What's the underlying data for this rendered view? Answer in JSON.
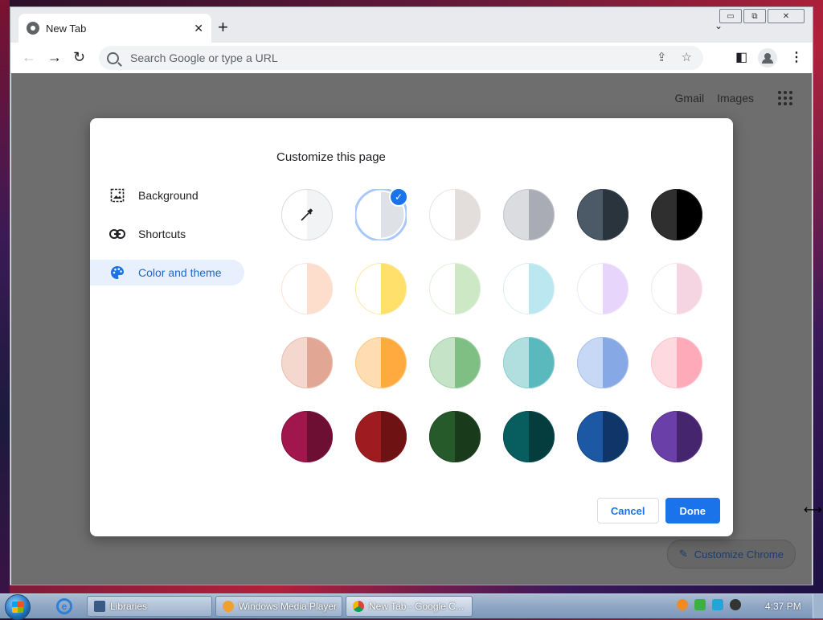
{
  "window": {
    "controls": {
      "minimize": "▭",
      "restore": "⧉",
      "close": "✕"
    }
  },
  "tab": {
    "title": "New Tab",
    "close": "✕",
    "new_tab": "+",
    "dropdown": "⌄"
  },
  "toolbar": {
    "back": "←",
    "forward": "→",
    "reload": "↻",
    "omnibox_placeholder": "Search Google or type a URL",
    "share": "⇪",
    "bookmark": "☆",
    "side_panel": "◧",
    "menu": "⋮"
  },
  "page": {
    "links": [
      "Gmail",
      "Images"
    ],
    "customize_label": "Customize Chrome"
  },
  "dialog": {
    "title": "Customize this page",
    "nav": [
      {
        "label": "Background",
        "icon": "image-icon"
      },
      {
        "label": "Shortcuts",
        "icon": "link-icon"
      },
      {
        "label": "Color and theme",
        "icon": "palette-icon",
        "active": true
      }
    ],
    "swatches": [
      {
        "name": "custom-color",
        "left": "#ffffff",
        "right": "#f1f3f4",
        "border": "#dadce0",
        "eyedropper": true
      },
      {
        "name": "default",
        "left": "#ffffff",
        "right": "#dee1e6",
        "border": "#a8c7fa",
        "selected": true
      },
      {
        "name": "warm-grey",
        "left": "#ffffff",
        "right": "#e3dedb",
        "border": "#e7e3e0"
      },
      {
        "name": "cool-grey",
        "left": "#dadce0",
        "right": "#a9acb5",
        "border": "#c3c6cc"
      },
      {
        "name": "blue-grey",
        "left": "#4b5a66",
        "right": "#2a343c",
        "border": "#3a4650"
      },
      {
        "name": "black",
        "left": "#2f2f2f",
        "right": "#000000",
        "border": "#202124"
      },
      {
        "name": "beige-and-white",
        "left": "#ffffff",
        "right": "#fdddcc",
        "border": "#f8e4d9"
      },
      {
        "name": "yellow-and-white",
        "left": "#ffffff",
        "right": "#ffe06a",
        "border": "#f9e9a6"
      },
      {
        "name": "green-and-white",
        "left": "#ffffff",
        "right": "#cde8c4",
        "border": "#e1f0db"
      },
      {
        "name": "light-teal-and-white",
        "left": "#ffffff",
        "right": "#bbe8f0",
        "border": "#d8f0f4"
      },
      {
        "name": "light-purple-and-white",
        "left": "#ffffff",
        "right": "#e7d5fb",
        "border": "#f0e6fb"
      },
      {
        "name": "pink-and-white",
        "left": "#ffffff",
        "right": "#f6d5e3",
        "border": "#f7e4ec"
      },
      {
        "name": "beige",
        "left": "#f4d8cf",
        "right": "#e2a794",
        "border": "#e9bfb1"
      },
      {
        "name": "orange",
        "left": "#ffdcb1",
        "right": "#ffaa3f",
        "border": "#ffc98a"
      },
      {
        "name": "light-green",
        "left": "#c4e3c7",
        "right": "#7fbf84",
        "border": "#a3d2a7"
      },
      {
        "name": "light-teal",
        "left": "#b1dfe0",
        "right": "#5ab9bd",
        "border": "#8fcdd0"
      },
      {
        "name": "light-blue",
        "left": "#c6d8f5",
        "right": "#86a8e4",
        "border": "#a9c0ec"
      },
      {
        "name": "pink",
        "left": "#ffd9e0",
        "right": "#ffaab8",
        "border": "#ffc3cd"
      },
      {
        "name": "dark-pink-and-red",
        "left": "#a0164d",
        "right": "#6d0e33",
        "border": "#861240"
      },
      {
        "name": "dark-red-and-orange",
        "left": "#9e1c20",
        "right": "#6e1214",
        "border": "#88181b"
      },
      {
        "name": "dark-green",
        "left": "#275a2a",
        "right": "#193a1b",
        "border": "#204a23"
      },
      {
        "name": "dark-teal",
        "left": "#085d5f",
        "right": "#053d3f",
        "border": "#074e50"
      },
      {
        "name": "dark-blue",
        "left": "#1d58a4",
        "right": "#0f3569",
        "border": "#174887"
      },
      {
        "name": "purple",
        "left": "#6b3fa8",
        "right": "#45266e",
        "border": "#5a338d"
      }
    ],
    "cancel_label": "Cancel",
    "done_label": "Done"
  },
  "taskbar": {
    "items": [
      {
        "label": "Libraries",
        "icon": "folder-icon"
      },
      {
        "label": "Windows Media Player",
        "icon": "media-player-icon"
      },
      {
        "label": "New Tab - Google C...",
        "icon": "chrome-icon",
        "active": true
      }
    ],
    "clock": "4:37 PM"
  }
}
